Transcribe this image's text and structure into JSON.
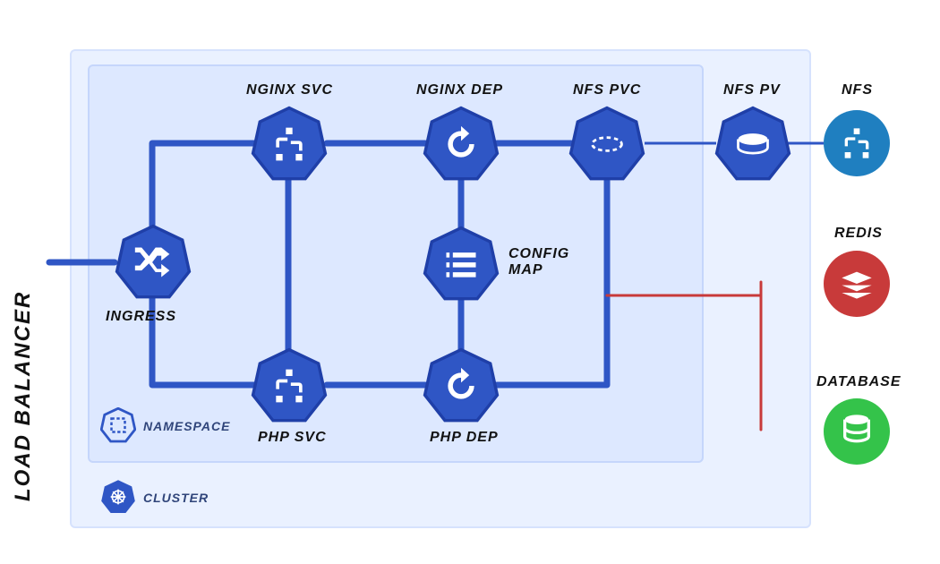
{
  "external_label": "LOAD BALANCER",
  "boxes": {
    "namespace_legend": "NAMESPACE",
    "cluster_legend": "CLUSTER"
  },
  "nodes": {
    "ingress": {
      "label": "INGRESS",
      "icon": "shuffle-icon",
      "label_pos": "below-left"
    },
    "nginx_svc": {
      "label": "NGINX SVC",
      "icon": "sitemap-icon",
      "label_pos": "above"
    },
    "nginx_dep": {
      "label": "NGINX DEP",
      "icon": "cycle-icon",
      "label_pos": "above"
    },
    "nfs_pvc": {
      "label": "NFS PVC",
      "icon": "pvc-icon",
      "label_pos": "above"
    },
    "nfs_pv": {
      "label": "NFS PV",
      "icon": "pv-icon",
      "label_pos": "above"
    },
    "config": {
      "label": "CONFIG MAP",
      "icon": "list-icon",
      "label_pos": "right"
    },
    "php_svc": {
      "label": "PHP SVC",
      "icon": "sitemap-icon",
      "label_pos": "below"
    },
    "php_dep": {
      "label": "PHP DEP",
      "icon": "cycle-icon",
      "label_pos": "below"
    }
  },
  "externals": {
    "nfs": {
      "label": "NFS",
      "icon": "sitemap-icon",
      "color": "#1f7fc0"
    },
    "redis": {
      "label": "REDIS",
      "icon": "redis-icon",
      "color": "#c83a3a"
    },
    "database": {
      "label": "DATABASE",
      "icon": "db-icon",
      "color": "#34c34a"
    }
  },
  "colors": {
    "k8s_blue": "#2f56c5",
    "hept_stroke": "#1f3fa8",
    "bg_cluster": "#eaf1ff",
    "bg_namespace": "#dde8ff"
  }
}
